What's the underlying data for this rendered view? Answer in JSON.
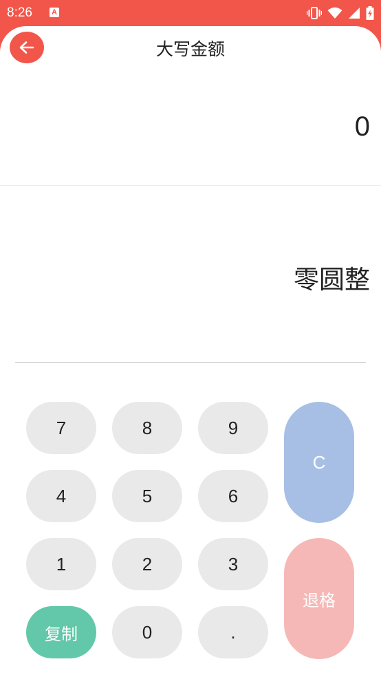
{
  "status_bar": {
    "time": "8:26",
    "a_icon_letter": "A",
    "icons": [
      "vibrate-icon",
      "wifi-icon",
      "signal-icon",
      "battery-charging-icon"
    ]
  },
  "header": {
    "title": "大写金额",
    "back_icon": "arrow-left-icon"
  },
  "display": {
    "input_value": "0",
    "result_text": "零圆整"
  },
  "keypad": {
    "keys": {
      "seven": "7",
      "eight": "8",
      "nine": "9",
      "four": "4",
      "five": "5",
      "six": "6",
      "one": "1",
      "two": "2",
      "three": "3",
      "zero": "0",
      "dot": ".",
      "clear": "C",
      "backspace": "退格",
      "copy": "复制"
    }
  },
  "colors": {
    "brand": "#f2564a",
    "key_bg": "#e9e9e9",
    "clear_bg": "#a7bfe5",
    "backspace_bg": "#f6b8b6",
    "copy_bg": "#62c8a9"
  }
}
